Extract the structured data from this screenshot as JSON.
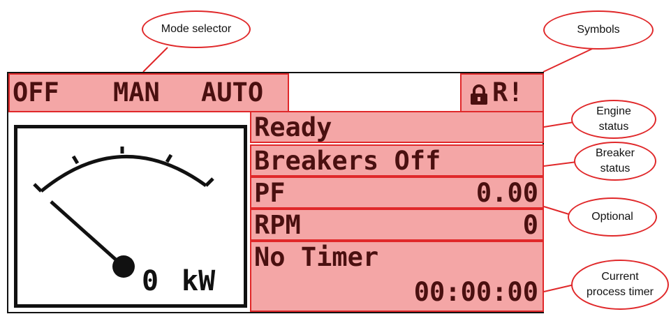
{
  "callouts": {
    "mode_selector": "Mode selector",
    "symbols": "Symbols",
    "engine_status": [
      "Engine",
      "status"
    ],
    "breaker_status": [
      "Breaker",
      "status"
    ],
    "optional": "Optional",
    "process_timer": [
      "Current",
      "process timer"
    ]
  },
  "mode": {
    "off": "OFF",
    "man": "MAN",
    "auto": "AUTO"
  },
  "symbols": {
    "lock_icon": "lock-icon",
    "text": "R!"
  },
  "status": {
    "engine": "Ready",
    "breakers": "Breakers Off",
    "pf_label": "PF",
    "pf_value": "0.00",
    "rpm_label": "RPM",
    "rpm_value": "0",
    "timer_label": "No Timer",
    "timer_value": "00:00:00"
  },
  "gauge": {
    "value": "0",
    "unit": "kW"
  },
  "colors": {
    "highlight": "#f4a6a6",
    "outline": "#e0282a",
    "text": "#4a1010"
  }
}
